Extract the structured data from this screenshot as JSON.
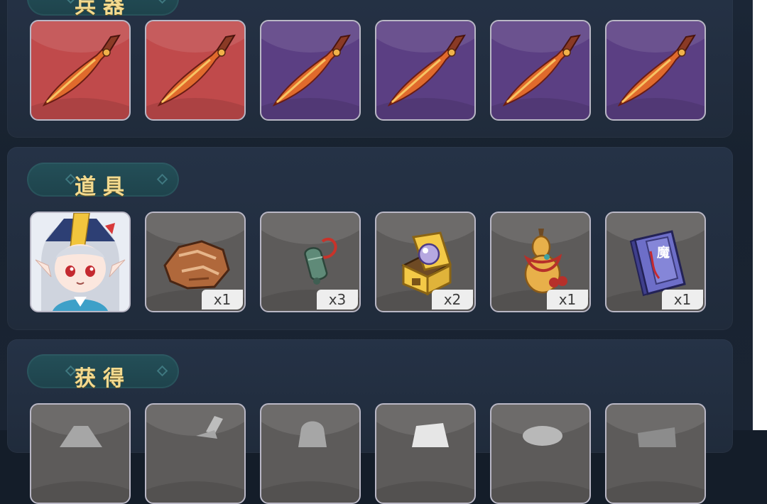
{
  "sections": [
    {
      "title": "兵器"
    },
    {
      "title": "道具"
    },
    {
      "title": "获得"
    }
  ],
  "items": {
    "character_portrait": {
      "icon": "elf-girl-portrait-icon"
    },
    "ore": {
      "icon": "ore-icon",
      "count": "x1"
    },
    "bell": {
      "icon": "bell-icon",
      "count": "x3"
    },
    "chest": {
      "icon": "treasure-chest-icon",
      "count": "x2"
    },
    "gourd": {
      "icon": "gourd-icon",
      "count": "x1"
    },
    "book": {
      "icon": "magic-book-icon",
      "count": "x1",
      "glyph": "魔"
    }
  },
  "colors": {
    "rarity_red": "#c04a4b",
    "rarity_purple": "#5b3f83",
    "rarity_gray": "#5d5b5a",
    "title_gold": "#f3da8f",
    "tag_teal": "#244f58"
  }
}
